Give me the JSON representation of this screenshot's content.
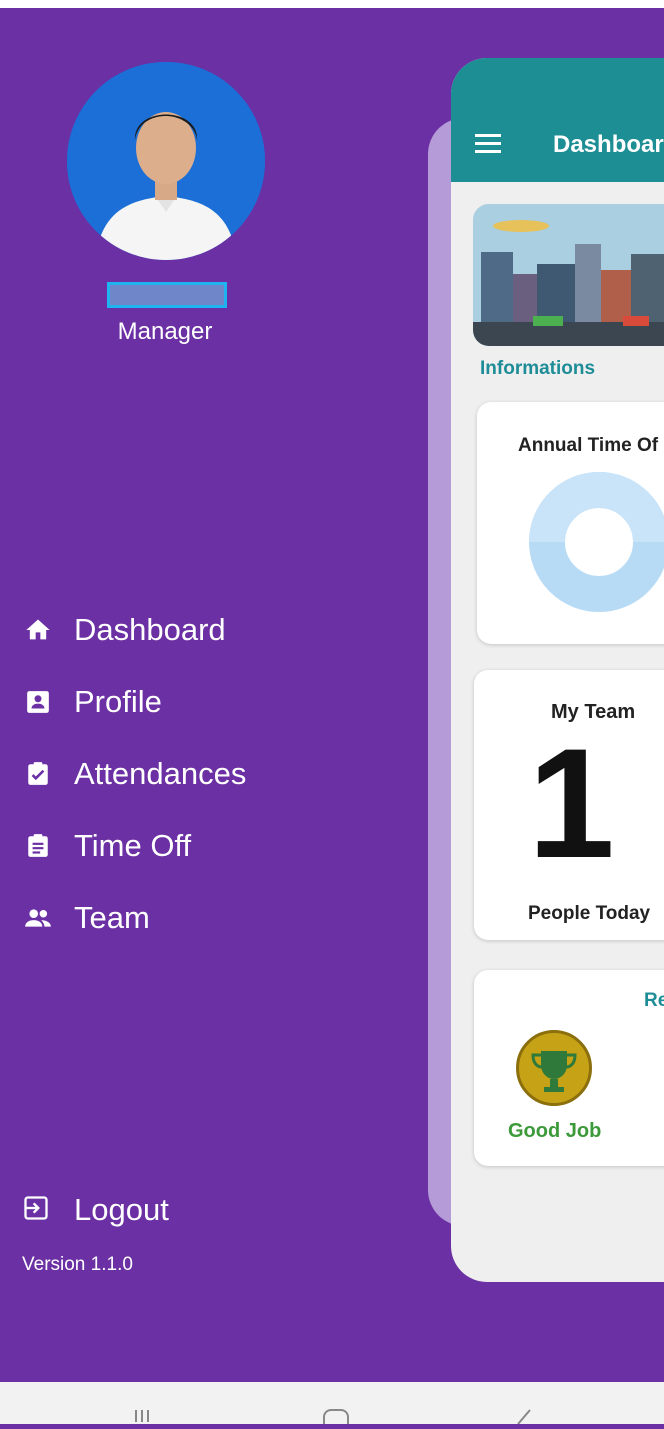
{
  "drawer": {
    "role": "Manager",
    "nav": [
      {
        "label": "Dashboard",
        "icon": "home-icon"
      },
      {
        "label": "Profile",
        "icon": "profile-card-icon"
      },
      {
        "label": "Attendances",
        "icon": "clipboard-check-icon"
      },
      {
        "label": "Time Off",
        "icon": "clipboard-list-icon"
      },
      {
        "label": "Team",
        "icon": "people-icon"
      }
    ],
    "logout_label": "Logout",
    "version": "Version 1.1.0"
  },
  "main": {
    "appbar_title": "Dashboar",
    "section_label": "Informations",
    "annual_card": {
      "title": "Annual Time Of"
    },
    "team_card": {
      "title": "My Team",
      "count": "1",
      "caption": "People Today"
    },
    "reward_card": {
      "title": "Re",
      "badge_label": "Good Job"
    }
  },
  "colors": {
    "drawer_bg": "#6b30a3",
    "appbar": "#1c8e94",
    "accent_text": "#1e8d97",
    "success_text": "#3d9a3a"
  }
}
